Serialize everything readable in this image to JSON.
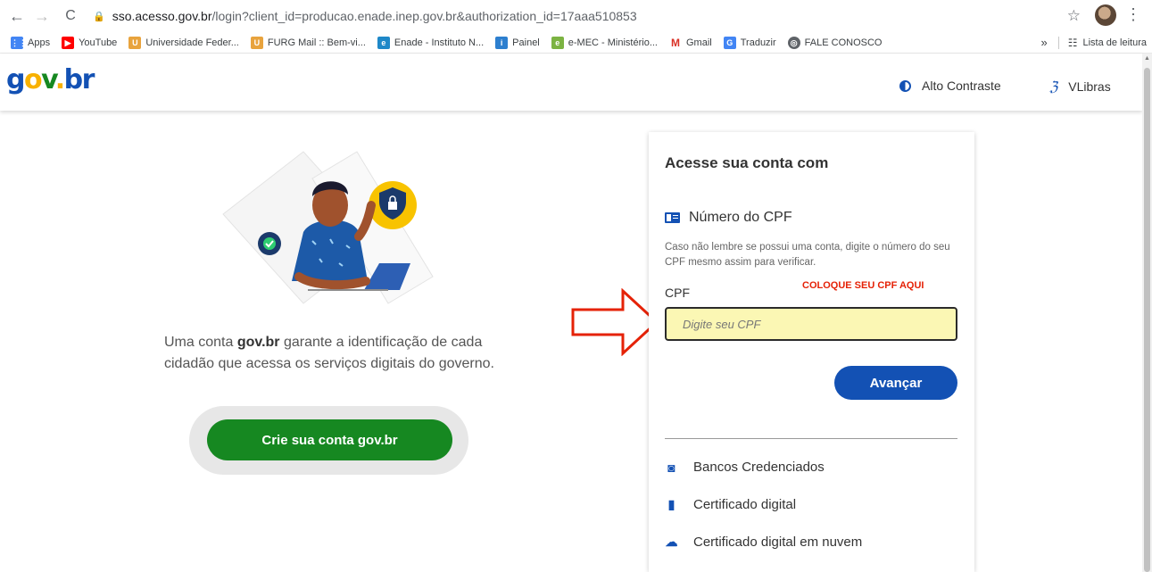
{
  "browser": {
    "url_host": "sso.acesso.gov.br",
    "url_path": "/login?client_id=producao.enade.inep.gov.br&authorization_id=17aaa510853",
    "bookmarks": [
      {
        "label": "Apps",
        "icon": "apps-grid-icon",
        "color": "#4285f4"
      },
      {
        "label": "YouTube",
        "icon": "youtube-icon",
        "color": "#ff0000"
      },
      {
        "label": "Universidade Feder...",
        "icon": "furg-icon",
        "color": "#e8a33d"
      },
      {
        "label": "FURG Mail :: Bem-vi...",
        "icon": "furg-mail-icon",
        "color": "#e8a33d"
      },
      {
        "label": "Enade - Instituto N...",
        "icon": "enade-icon",
        "color": "#1e88c8"
      },
      {
        "label": "Painel",
        "icon": "inep-icon",
        "color": "#2d7fcf"
      },
      {
        "label": "e-MEC - Ministério...",
        "icon": "emec-icon",
        "color": "#7cb342"
      },
      {
        "label": "Gmail",
        "icon": "gmail-icon",
        "color": "#d93025"
      },
      {
        "label": "Traduzir",
        "icon": "translate-icon",
        "color": "#4285f4"
      },
      {
        "label": "FALE CONOSCO",
        "icon": "globe-icon",
        "color": "#5f6368"
      }
    ],
    "more": "»",
    "reading_list": "Lista de leitura"
  },
  "header": {
    "logo": {
      "g": "g",
      "o": "o",
      "v": "v",
      "dot": ".",
      "br": "br"
    },
    "contrast": "Alto Contraste",
    "vlibras": "VLibras"
  },
  "left": {
    "intro_pre": "Uma conta ",
    "intro_bold": "gov.br",
    "intro_post": " garante a identificação de cada cidadão que acessa os serviços digitais do governo.",
    "create_button": "Crie sua conta gov.br"
  },
  "card": {
    "title": "Acesse sua conta com",
    "cpf_heading": "Número do CPF",
    "hint": "Caso não lembre se possui uma conta, digite o número do seu CPF mesmo assim para verificar.",
    "field_label": "CPF",
    "annotation": "COLOQUE SEU CPF AQUI",
    "placeholder": "Digite seu CPF",
    "next_button": "Avançar",
    "options": [
      {
        "label": "Bancos Credenciados",
        "icon": "bank-icon"
      },
      {
        "label": "Certificado digital",
        "icon": "usb-token-icon"
      },
      {
        "label": "Certificado digital em nuvem",
        "icon": "cloud-lock-icon"
      }
    ]
  },
  "colors": {
    "primary_blue": "#1351b4",
    "green": "#168821",
    "input_highlight": "#fbf7b4",
    "annotation_red": "#e52207"
  }
}
